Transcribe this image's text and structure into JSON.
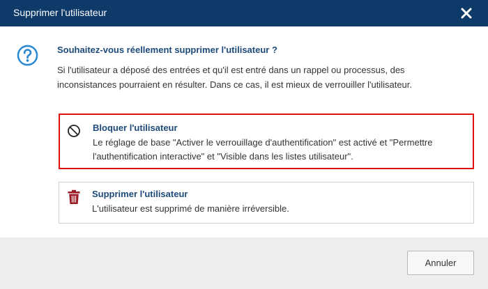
{
  "dialog": {
    "title": "Supprimer l'utilisateur",
    "close_icon": "close-icon",
    "question_icon": "question-circle-icon",
    "question": "Souhaitez-vous réellement supprimer l'utilisateur ?",
    "description": "Si l'utilisateur a déposé des entrées et qu'il est entré dans un rappel ou processus, des inconsistances pourraient en résulter. Dans ce cas, il est mieux de verrouiller l'utilisateur."
  },
  "options": {
    "block": {
      "icon": "prohibited-icon",
      "title": "Bloquer l'utilisateur",
      "description": "Le réglage de base \"Activer le verrouillage d'authentification\" est activé et \"Permettre l'authentification interactive\" et \"Visible dans les listes utilisateur\"."
    },
    "delete": {
      "icon": "trash-icon",
      "title": "Supprimer l'utilisateur",
      "description": "L'utilisateur est supprimé de manière irréversible."
    }
  },
  "footer": {
    "cancel_label": "Annuler"
  },
  "colors": {
    "titlebar": "#0e3a6a",
    "accent_blue": "#2a8ad4",
    "heading_blue": "#1d4a7a",
    "selected_border": "#e01010",
    "trash_red": "#9b1c24",
    "footer_bg": "#eceef0"
  }
}
